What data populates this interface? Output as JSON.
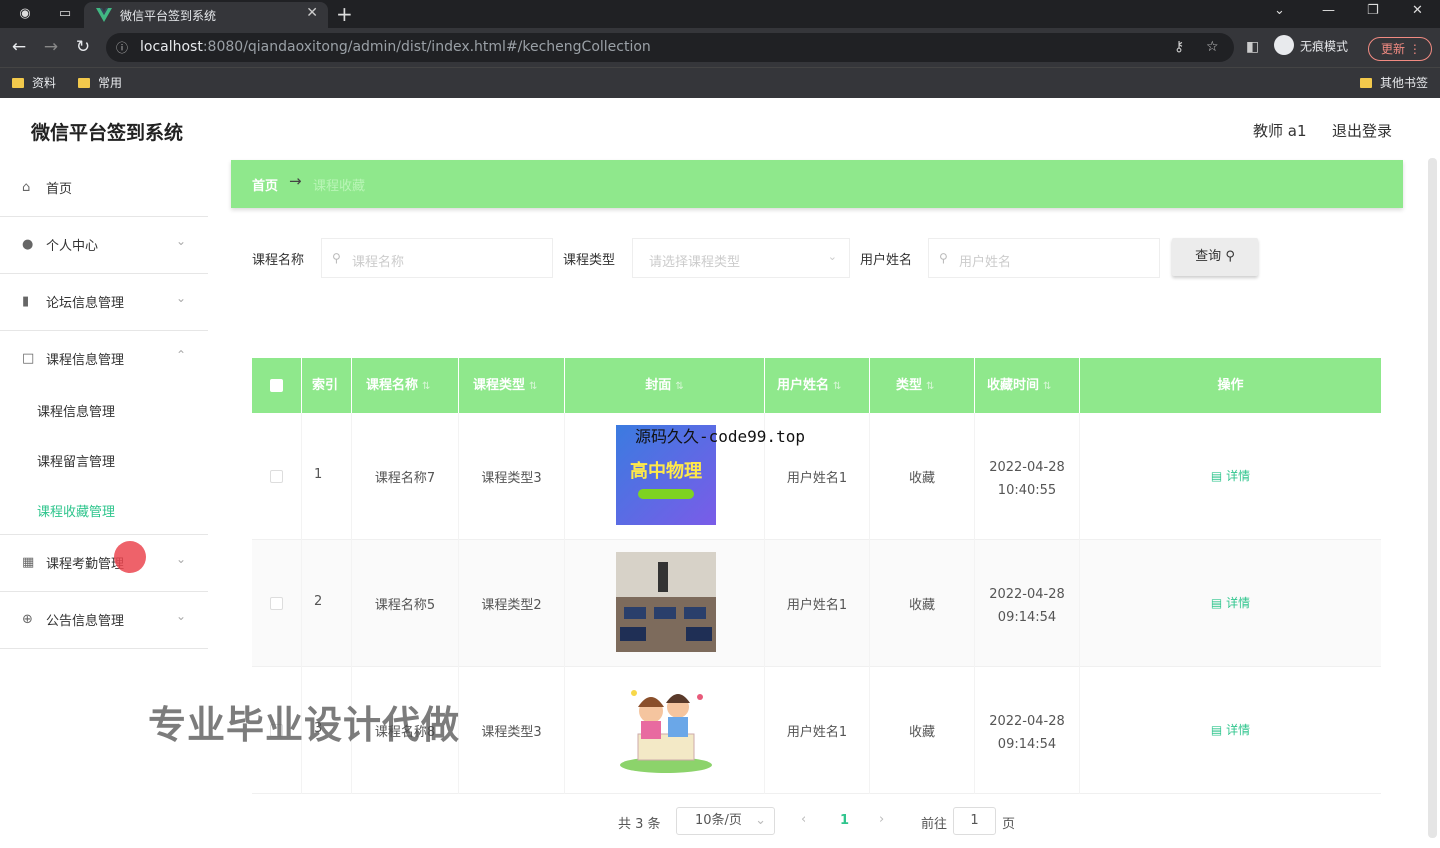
{
  "browser": {
    "tab_title": "微信平台签到系统",
    "url_host": "localhost",
    "url_rest": ":8080/qiandaoxitong/admin/dist/index.html#/kechengCollection",
    "incognito_label": "无痕模式",
    "update_label": "更新",
    "bookmarks": [
      "资料",
      "常用"
    ],
    "other_bookmarks": "其他书签"
  },
  "header": {
    "title": "微信平台签到系统",
    "user": "教师 a1",
    "logout": "退出登录"
  },
  "sidebar": {
    "items": [
      {
        "label": "首页"
      },
      {
        "label": "个人中心"
      },
      {
        "label": "论坛信息管理"
      },
      {
        "label": "课程信息管理"
      },
      {
        "label": "课程考勤管理"
      },
      {
        "label": "公告信息管理"
      }
    ],
    "submenu": [
      "课程信息管理",
      "课程留言管理",
      "课程收藏管理"
    ]
  },
  "breadcrumb": {
    "home": "首页",
    "sep": "→",
    "current": "课程收藏"
  },
  "search": {
    "course_name_label": "课程名称",
    "course_name_placeholder": "课程名称",
    "course_type_label": "课程类型",
    "course_type_placeholder": "请选择课程类型",
    "user_name_label": "用户姓名",
    "user_name_placeholder": "用户姓名",
    "query_button": "查询"
  },
  "table": {
    "columns": [
      "索引",
      "课程名称",
      "课程类型",
      "封面",
      "用户姓名",
      "类型",
      "收藏时间",
      "操作"
    ],
    "rows": [
      {
        "index": "1",
        "course": "课程名称7",
        "type": "课程类型3",
        "user": "用户姓名1",
        "kind": "收藏",
        "date": "2022-04-28",
        "time": "10:40:55",
        "action": "详情"
      },
      {
        "index": "2",
        "course": "课程名称5",
        "type": "课程类型2",
        "user": "用户姓名1",
        "kind": "收藏",
        "date": "2022-04-28",
        "time": "09:14:54",
        "action": "详情"
      },
      {
        "index": "3",
        "course": "课程名称8",
        "type": "课程类型3",
        "user": "用户姓名1",
        "kind": "收藏",
        "date": "2022-04-28",
        "time": "09:14:54",
        "action": "详情"
      }
    ]
  },
  "cover1_text": "高中物理",
  "pagination": {
    "total": "共 3 条",
    "page_size": "10条/页",
    "current": "1",
    "goto_label": "前往",
    "goto_value": "1",
    "page_suffix": "页"
  },
  "overlays": {
    "source_watermark": "源码久久-code99.top",
    "promo": "专业毕业设计代做"
  },
  "colors": {
    "accent": "#8fe88c",
    "active": "#2fc58d"
  }
}
